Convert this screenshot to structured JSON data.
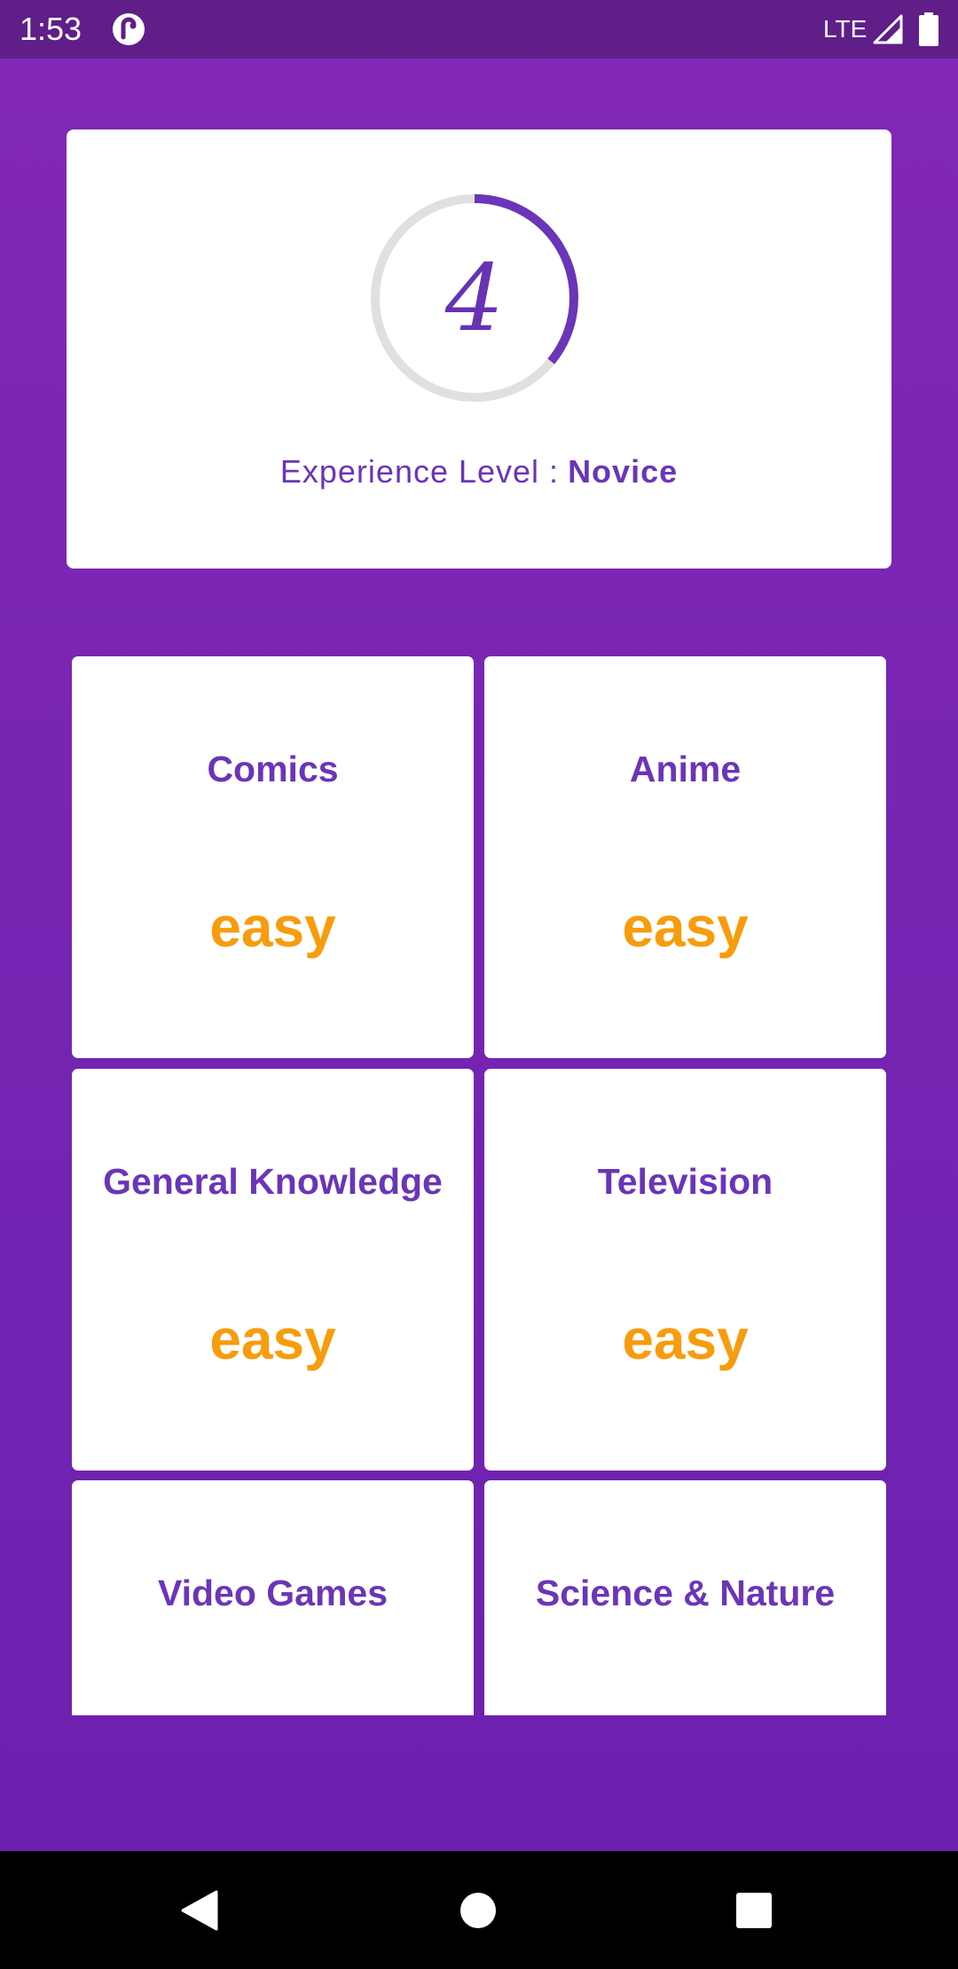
{
  "status_bar": {
    "time": "1:53",
    "app_icon": "app-notification-icon",
    "network": "LTE",
    "signal_icon": "cell-signal-icon",
    "battery_icon": "battery-full-icon"
  },
  "experience": {
    "level_number": "4",
    "label": "Experience Level :",
    "level_name": "Novice",
    "progress_fraction": 0.36
  },
  "categories": [
    {
      "title": "Comics",
      "difficulty": "easy"
    },
    {
      "title": "Anime",
      "difficulty": "easy"
    },
    {
      "title": "General Knowledge",
      "difficulty": "easy"
    },
    {
      "title": "Television",
      "difficulty": "easy"
    },
    {
      "title": "Video Games",
      "difficulty": ""
    },
    {
      "title": "Science & Nature",
      "difficulty": ""
    }
  ],
  "nav_bar": {
    "back_icon": "back-triangle-icon",
    "home_icon": "home-circle-icon",
    "recents_icon": "recents-square-icon"
  },
  "colors": {
    "accent_purple": "#6a35b8",
    "difficulty_orange": "#f79c0d",
    "background_top": "#8228b8",
    "background_bottom": "#6a20ad",
    "status_bar": "#5f1e88",
    "ring_track": "#e0e0e0"
  }
}
